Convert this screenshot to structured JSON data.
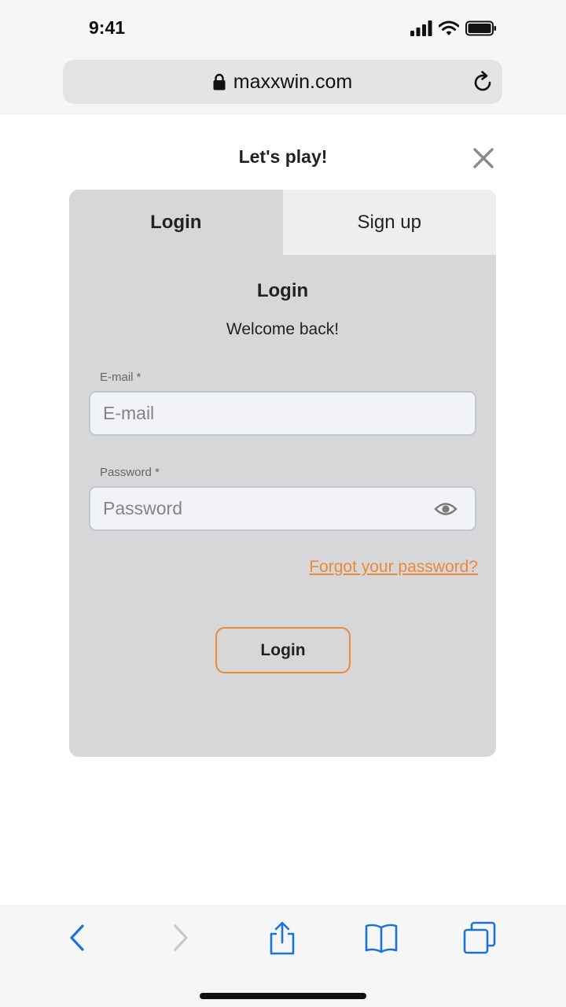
{
  "status_bar": {
    "time": "9:41"
  },
  "browser": {
    "url": "maxxwin.com"
  },
  "modal": {
    "title": "Let's play!",
    "tabs": [
      {
        "label": "Login",
        "active": true
      },
      {
        "label": "Sign up",
        "active": false
      }
    ],
    "heading": "Login",
    "subheading": "Welcome back!",
    "email": {
      "label": "E-mail *",
      "placeholder": "E-mail",
      "value": ""
    },
    "password": {
      "label": "Password *",
      "placeholder": "Password",
      "value": ""
    },
    "forgot_link": "Forgot your password?",
    "submit_label": "Login"
  },
  "colors": {
    "accent": "#ea8a36",
    "card_bg": "#d7d7da",
    "inactive_tab_bg": "#efefef",
    "toolbar_icon": "#1a73d9",
    "disabled_icon": "#c8c8c8"
  },
  "icons": [
    "signal-icon",
    "wifi-icon",
    "battery-icon",
    "lock-icon",
    "reload-icon",
    "close-icon",
    "eye-icon",
    "back-icon",
    "forward-icon",
    "share-icon",
    "bookmarks-icon",
    "tabs-icon"
  ]
}
